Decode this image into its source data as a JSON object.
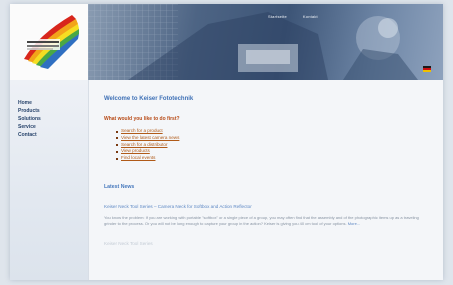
{
  "header": {
    "logo_alt": "Keiser Fototechnik logo",
    "topnav": [
      "Startseite",
      "Kontakt"
    ],
    "flag_colors": [
      "#1a1a1a",
      "#cc1111",
      "#f0c000"
    ]
  },
  "sidebar": {
    "items": [
      {
        "label": "Home"
      },
      {
        "label": "Products"
      },
      {
        "label": "Solutions"
      },
      {
        "label": "Service"
      },
      {
        "label": "Contact"
      }
    ]
  },
  "main": {
    "welcome": "Welcome to Keiser Fototechnik",
    "question": "What would you like to do first?",
    "links": [
      "Search for a product",
      "View the latest camera news",
      "Search for a distributor",
      "View products",
      "Find local events"
    ],
    "news": {
      "title": "Latest News",
      "headline": "Keiser Neck Tool Series – Camera Neck for Softbox and Action Reflector",
      "body": "You know the problem: If you are working with portable \"softbox\" or a single piece of a group, you may often find that the assembly and of the photographic items up as a traveling grinder to the process. Or you will not be long enough to capture your group in the action? Keiser is giving you 40 cm tool of your options.",
      "more": "More...",
      "next_headline": "Keiser Neck Tool Series"
    }
  },
  "colors": {
    "accent": "#3e70b6",
    "link": "#b05a18",
    "nav": "#28446c"
  }
}
